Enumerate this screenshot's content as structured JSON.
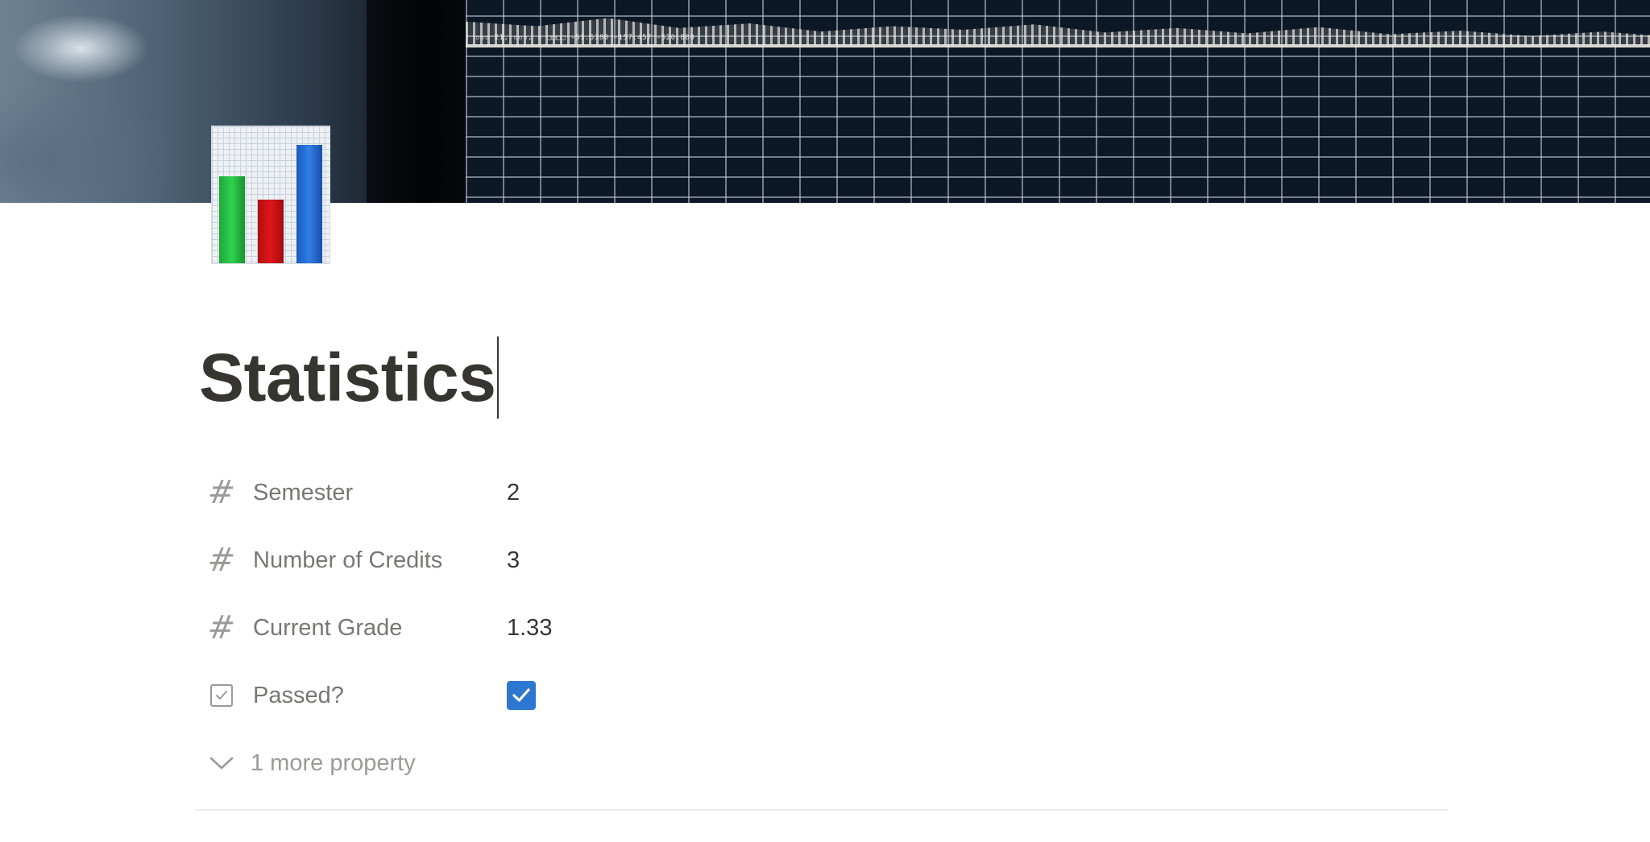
{
  "cover": {
    "icon": "cover-image-stock-chart",
    "readout": "▫▫▫ 21, ▫▫▫, ▫  □□□□  -51.5380  -157.457  -520.880"
  },
  "page": {
    "icon": "bar-chart-icon",
    "title": "Statistics"
  },
  "properties": [
    {
      "icon": "number-icon",
      "name": "Semester",
      "value": "2"
    },
    {
      "icon": "number-icon",
      "name": "Number of Credits",
      "value": "3"
    },
    {
      "icon": "number-icon",
      "name": "Current Grade",
      "value": "1.33"
    },
    {
      "icon": "checkbox-icon",
      "name": "Passed?",
      "checked": true
    }
  ],
  "more": {
    "icon": "chevron-down-icon",
    "label": "1 more property"
  },
  "colors": {
    "checkbox_checked": "#2e77d0",
    "text_primary": "#37352f",
    "text_secondary": "#787774",
    "text_tertiary": "#9b9a97"
  }
}
